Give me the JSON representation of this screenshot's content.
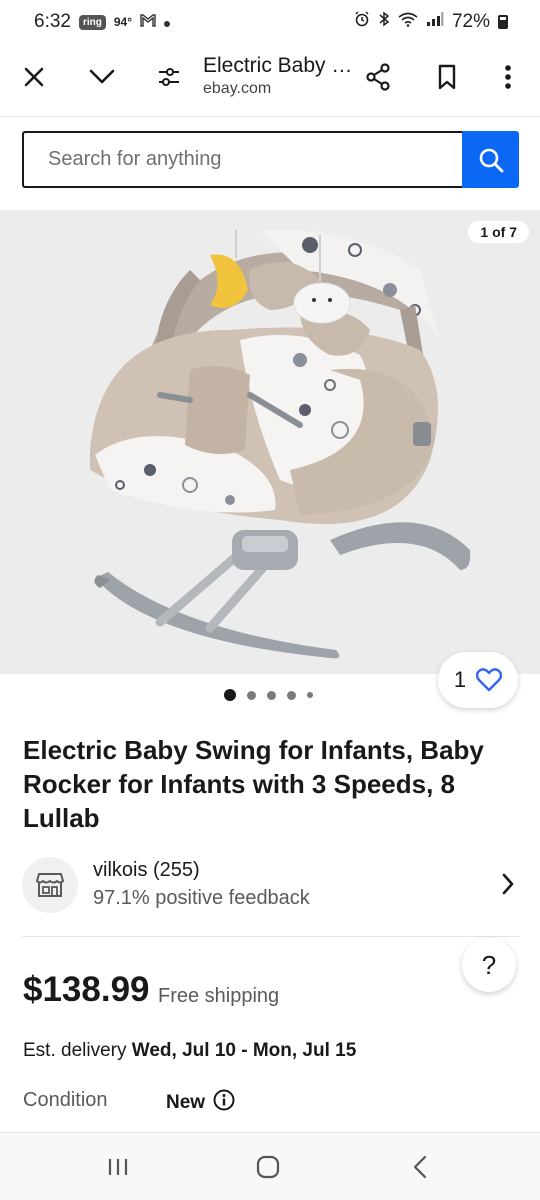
{
  "status_bar": {
    "time": "6:32",
    "ring_badge": "ring",
    "temperature": "94°",
    "battery": "72%"
  },
  "browser": {
    "page_title": "Electric Baby Swing for Infants",
    "domain": "ebay.com"
  },
  "search": {
    "placeholder": "Search for anything"
  },
  "gallery": {
    "counter": "1 of 7",
    "total_images": 7,
    "current_index": 1,
    "watch_count": "1"
  },
  "listing": {
    "title": "Electric Baby Swing for Infants, Baby Rocker for Infants with 3 Speeds, 8 Lullab",
    "seller_name": "vilkois (255)",
    "seller_feedback": "97.1% positive feedback",
    "price": "$138.99",
    "shipping": "Free shipping",
    "delivery_label": "Est. delivery",
    "delivery_dates": "Wed, Jul 10 - Mon, Jul 15",
    "condition_label": "Condition",
    "condition_value": "New"
  },
  "help": {
    "label": "?"
  },
  "colors": {
    "search_button": "#0a68f5",
    "watch_heart": "#3665f3",
    "text": "#191919"
  }
}
